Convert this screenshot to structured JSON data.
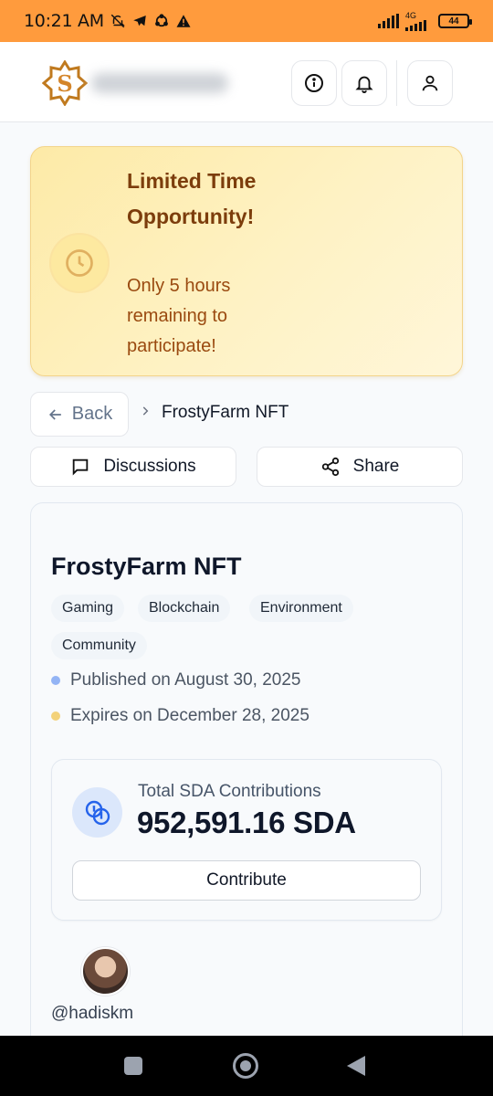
{
  "status_bar": {
    "time": "10:21 AM",
    "network": "4G",
    "battery": "44"
  },
  "header": {
    "info_label": "info",
    "notifications_label": "notifications",
    "profile_label": "profile"
  },
  "banner": {
    "title": "Limited Time Opportunity!",
    "subtitle": "Only 5 hours remaining to participate!"
  },
  "breadcrumb": {
    "back_label": "Back",
    "current": "FrostyFarm NFT"
  },
  "actions": {
    "discussions_label": "Discussions",
    "share_label": "Share"
  },
  "project": {
    "title": "FrostyFarm NFT",
    "tags": [
      "Gaming",
      "Blockchain",
      "Environment",
      "Community"
    ],
    "published": "Published on August 30, 2025",
    "expires": "Expires on December 28, 2025"
  },
  "contributions": {
    "label": "Total SDA Contributions",
    "amount": "952,591.16 SDA",
    "button_label": "Contribute"
  },
  "creator": {
    "username": "@hadiskm"
  },
  "colors": {
    "status_bar": "#ff9b3d",
    "banner_title": "#7c3d0c",
    "published_dot": "#93b4f5",
    "expires_dot": "#f3d27a"
  }
}
